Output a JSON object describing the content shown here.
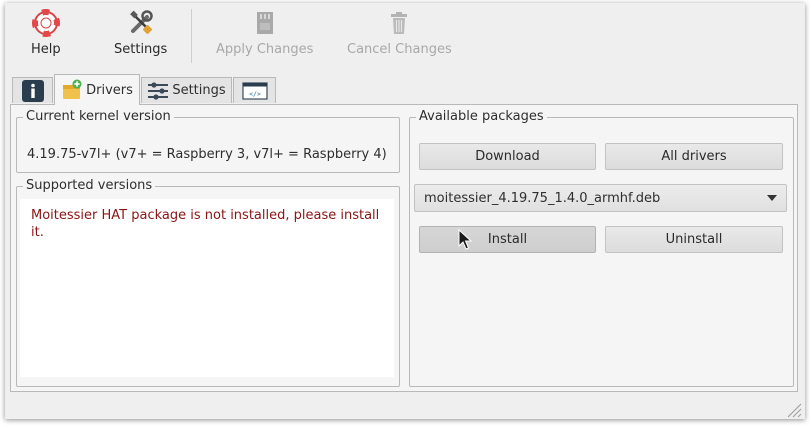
{
  "toolbar": {
    "help": {
      "label": "Help",
      "icon": "lifebuoy-icon"
    },
    "settings": {
      "label": "Settings",
      "icon": "tools-icon"
    },
    "apply": {
      "label": "Apply Changes",
      "icon": "sd-card-icon",
      "disabled": true
    },
    "cancel": {
      "label": "Cancel Changes",
      "icon": "trash-icon",
      "disabled": true
    }
  },
  "tabs": [
    {
      "label": "",
      "icon": "info-icon",
      "active": false
    },
    {
      "label": "Drivers",
      "icon": "drivers-icon",
      "active": true
    },
    {
      "label": "Settings",
      "icon": "sliders-icon",
      "active": false
    },
    {
      "label": "",
      "icon": "code-window-icon",
      "active": false
    }
  ],
  "kernel": {
    "title": "Current kernel version",
    "value": "4.19.75-v7l+ (v7+ = Raspberry 3, v7l+ = Raspberry 4)"
  },
  "supported": {
    "title": "Supported versions",
    "message": "Moitessier HAT package is not installed, please install it."
  },
  "packages": {
    "title": "Available packages",
    "download_label": "Download",
    "all_drivers_label": "All drivers",
    "selected_package": "moitessier_4.19.75_1.4.0_armhf.deb",
    "install_label": "Install",
    "uninstall_label": "Uninstall"
  },
  "colors": {
    "window_bg": "#efefef",
    "error_text": "#8b1414",
    "help_icon": "#e2484a"
  }
}
